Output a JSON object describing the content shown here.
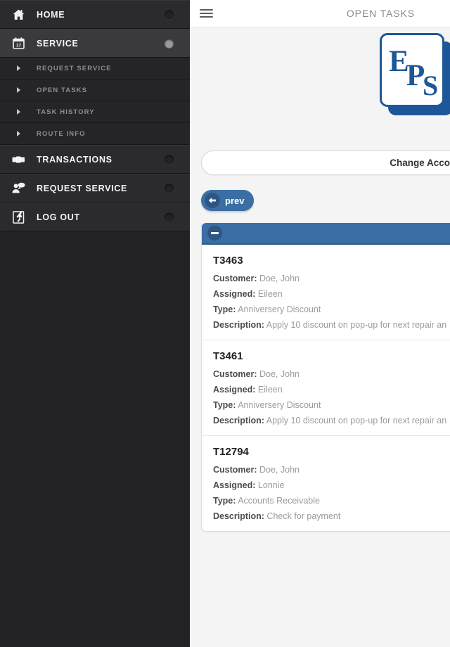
{
  "sidebar": {
    "items": [
      {
        "label": "HOME",
        "icon": "home-icon",
        "active": false,
        "dot": true
      },
      {
        "label": "SERVICE",
        "icon": "calendar-icon",
        "active": true,
        "dot": true
      },
      {
        "label": "TRANSACTIONS",
        "icon": "money-icon",
        "active": false,
        "dot": true
      },
      {
        "label": "REQUEST SERVICE",
        "icon": "person-message-icon",
        "active": false,
        "dot": true
      },
      {
        "label": "LOG OUT",
        "icon": "exit-door-icon",
        "active": false,
        "dot": true
      }
    ],
    "submenu": [
      {
        "label": "REQUEST SERVICE"
      },
      {
        "label": "OPEN TASKS"
      },
      {
        "label": "TASK HISTORY"
      },
      {
        "label": "ROUTE INFO"
      }
    ],
    "calendar_day": "17"
  },
  "header": {
    "menu_icon": "hamburger-icon",
    "title": "OPEN TASKS"
  },
  "logo": {
    "letters": [
      "E",
      "P",
      "S"
    ]
  },
  "account": {
    "change_label": "Change Account"
  },
  "pagination": {
    "prev_label": "prev",
    "prev_icon": "arrow-left-icon"
  },
  "panel": {
    "collapse_icon": "minus-icon",
    "labels": {
      "customer": "Customer:",
      "assigned": "Assigned:",
      "type": "Type:",
      "description": "Description:"
    },
    "tasks": [
      {
        "id": "T3463",
        "customer": "Doe, John",
        "assigned": "Eileen",
        "type": "Anniversery Discount",
        "description": "Apply 10 discount on pop-up for next repair an"
      },
      {
        "id": "T3461",
        "customer": "Doe, John",
        "assigned": "Eileen",
        "type": "Anniversery Discount",
        "description": "Apply 10 discount on pop-up for next repair an"
      },
      {
        "id": "T12794",
        "customer": "Doe, John",
        "assigned": "Lonnie",
        "type": "Accounts Receivable",
        "description": "Check for payment"
      }
    ]
  },
  "colors": {
    "accent_blue": "#3a6ea5",
    "logo_blue": "#1e5799",
    "sidebar_bg": "#2b2b2d",
    "sidebar_active": "#3a3a3c",
    "page_bg": "#f4f4f4"
  }
}
